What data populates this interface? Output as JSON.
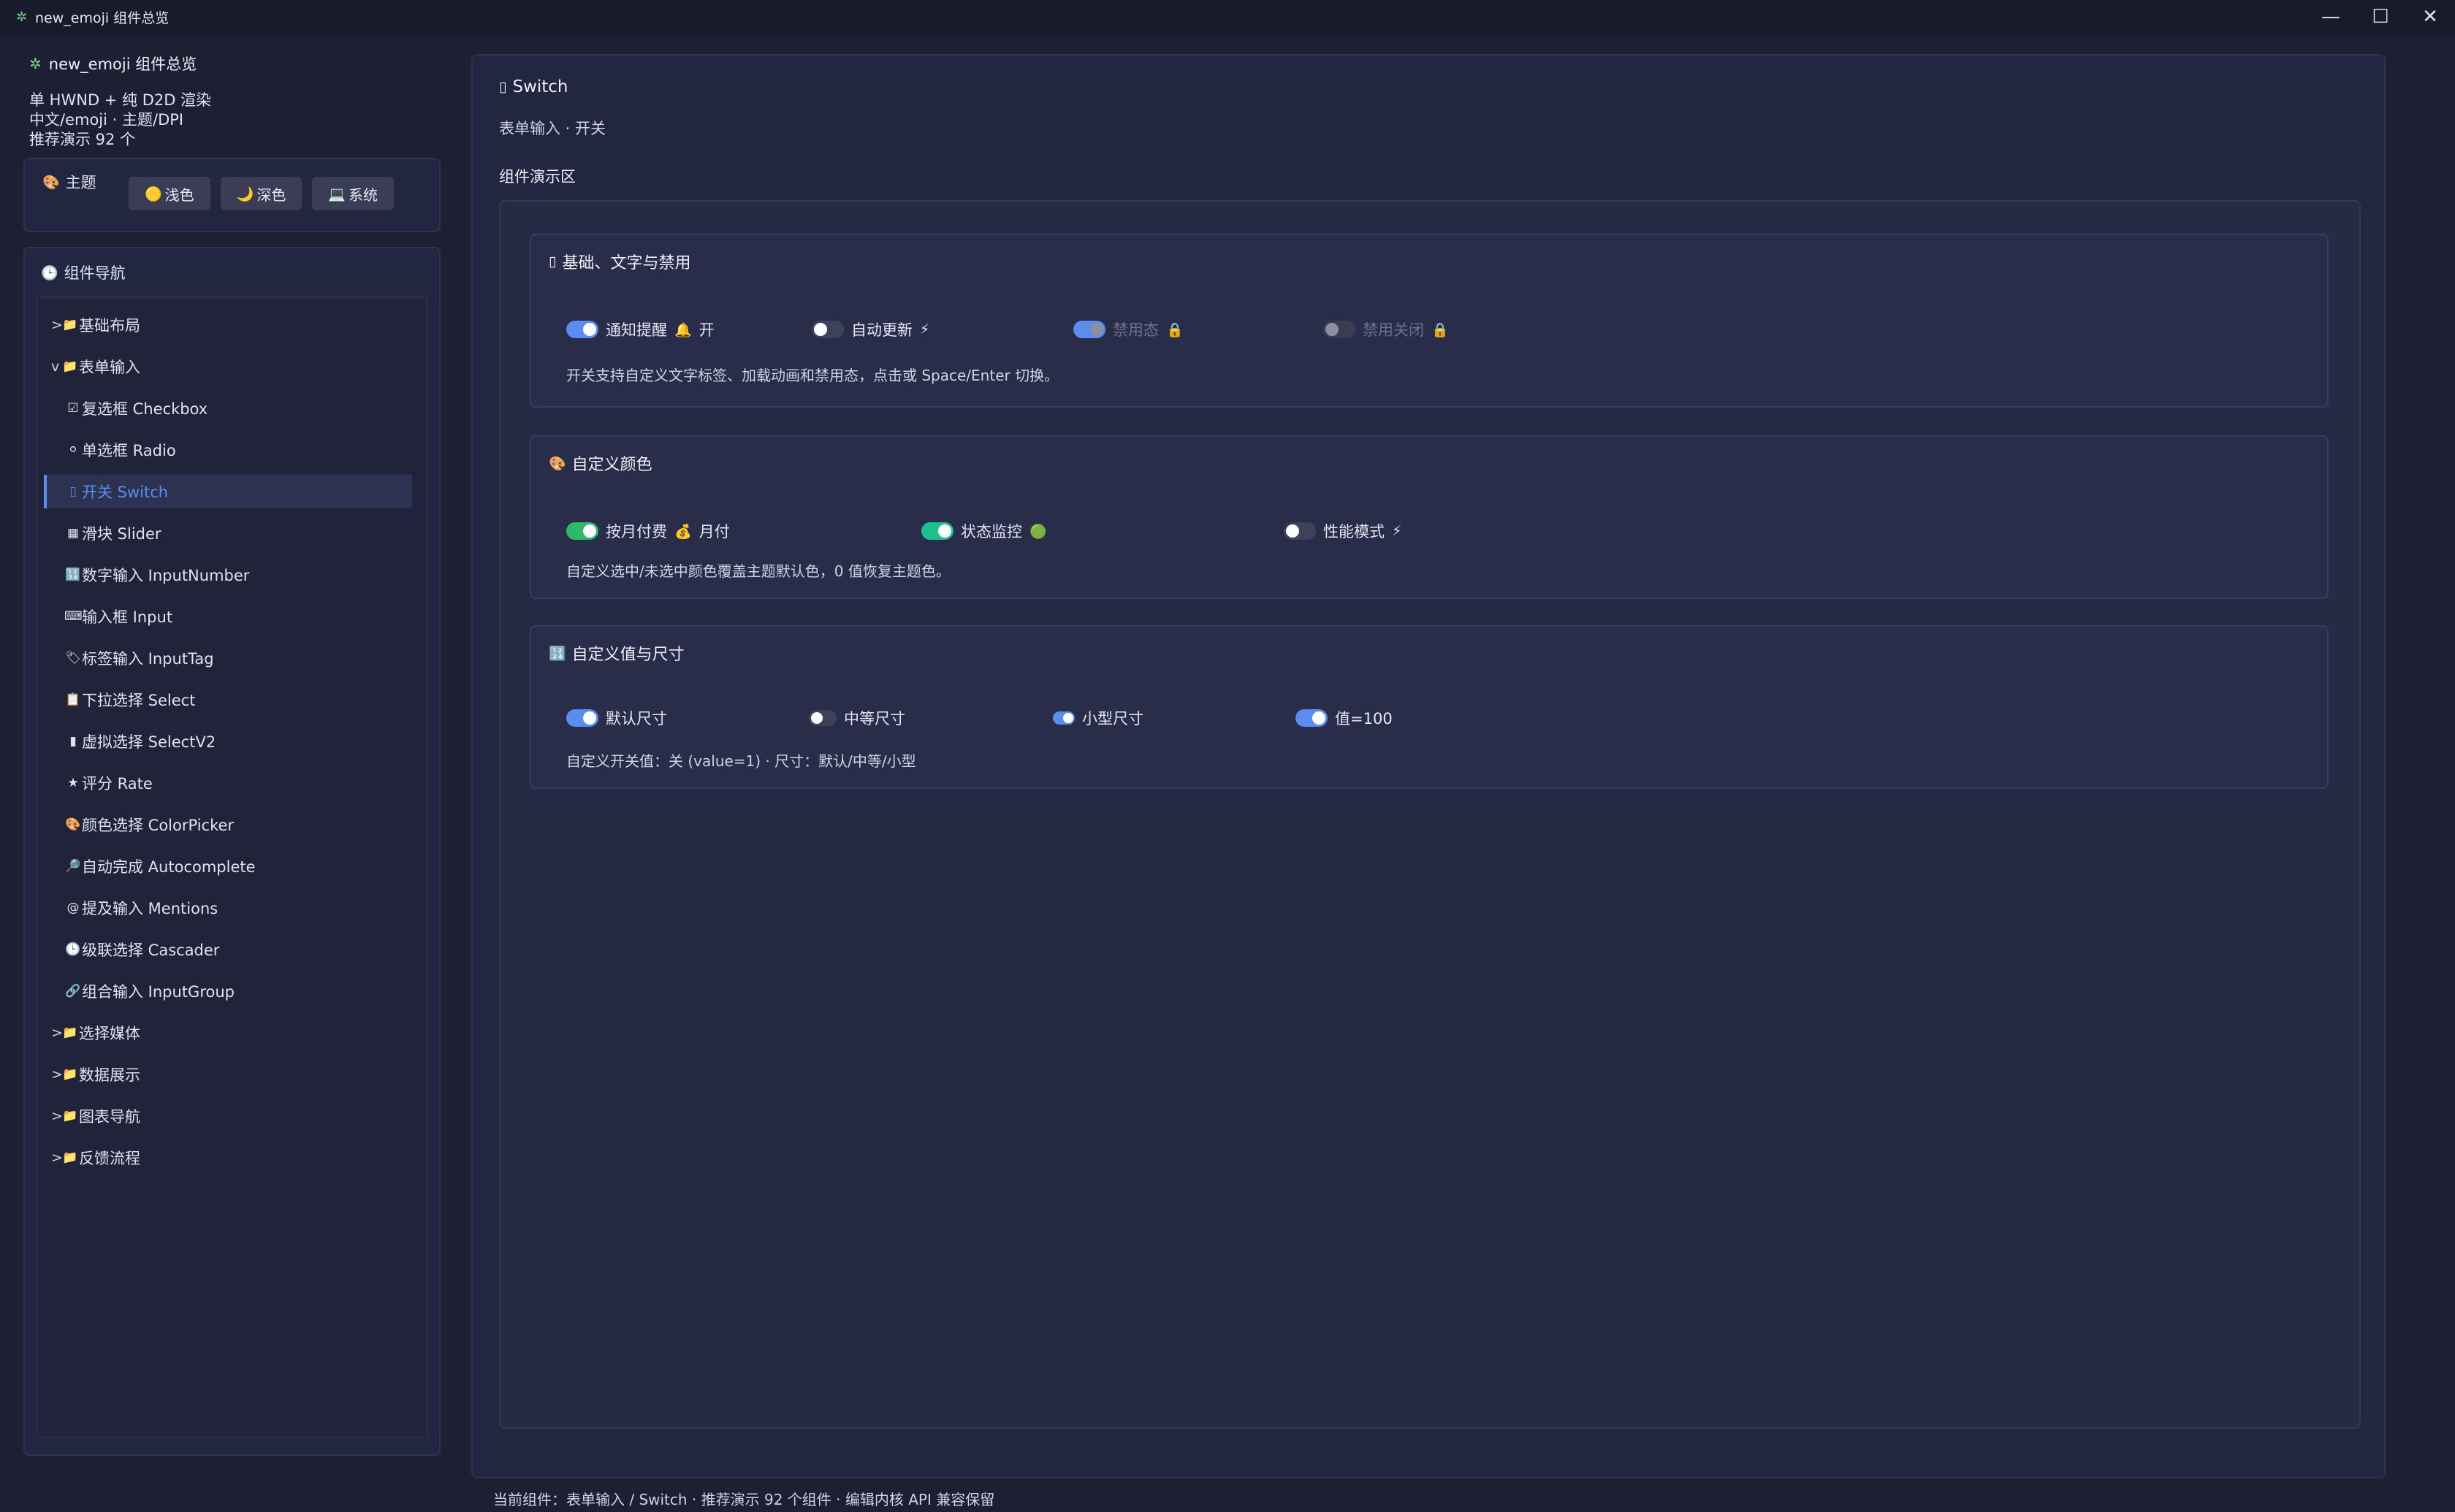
{
  "window": {
    "title": "new_emoji 组件总览",
    "controls": {
      "minimize": "—",
      "maximize": "☐",
      "close": "✕"
    }
  },
  "sidebar": {
    "app_name": "new_emoji 组件总览",
    "info_lines": [
      "单 HWND + 纯 D2D 渲染",
      "中文/emoji · 主题/DPI",
      "推荐演示 92 个"
    ],
    "theme": {
      "label": "主题",
      "buttons": [
        {
          "icon": "🟡",
          "label": "浅色"
        },
        {
          "icon": "🌙",
          "label": "深色"
        },
        {
          "icon": "💻",
          "label": "系统"
        }
      ]
    },
    "nav": {
      "title": "组件导航",
      "items": [
        {
          "arrow": ">",
          "icon": "📁",
          "label": "基础布局",
          "level": 0
        },
        {
          "arrow": "v",
          "icon": "📁",
          "label": "表单输入",
          "level": 0
        },
        {
          "icon": "☑",
          "label": "复选框 Checkbox",
          "level": 1
        },
        {
          "icon": "⚪",
          "label": "单选框 Radio",
          "level": 1
        },
        {
          "icon": "▯",
          "label": "开关 Switch",
          "level": 1,
          "active": true
        },
        {
          "icon": "▦",
          "label": "滑块 Slider",
          "level": 1
        },
        {
          "icon": "🔢",
          "label": "数字输入 InputNumber",
          "level": 1
        },
        {
          "icon": "⌨",
          "label": "输入框 Input",
          "level": 1
        },
        {
          "icon": "🏷",
          "label": "标签输入 InputTag",
          "level": 1
        },
        {
          "icon": "📋",
          "label": "下拉选择 Select",
          "level": 1
        },
        {
          "icon": "▮",
          "label": "虚拟选择 SelectV2",
          "level": 1
        },
        {
          "icon": "★",
          "label": "评分 Rate",
          "level": 1
        },
        {
          "icon": "🎨",
          "label": "颜色选择 ColorPicker",
          "level": 1
        },
        {
          "icon": "🔎",
          "label": "自动完成 Autocomplete",
          "level": 1
        },
        {
          "icon": "@",
          "label": "提及输入 Mentions",
          "level": 1
        },
        {
          "icon": "🕒",
          "label": "级联选择 Cascader",
          "level": 1
        },
        {
          "icon": "🔗",
          "label": "组合输入 InputGroup",
          "level": 1
        },
        {
          "arrow": ">",
          "icon": "📁",
          "label": "选择媒体",
          "level": 0
        },
        {
          "arrow": ">",
          "icon": "📁",
          "label": "数据展示",
          "level": 0
        },
        {
          "arrow": ">",
          "icon": "📁",
          "label": "图表导航",
          "level": 0
        },
        {
          "arrow": ">",
          "icon": "📁",
          "label": "反馈流程",
          "level": 0
        }
      ]
    }
  },
  "main": {
    "title": "Switch",
    "subtitle": "表单输入 · 开关",
    "demo_label": "组件演示区",
    "cards": [
      {
        "title": "基础、文字与禁用",
        "switches": [
          {
            "label": "通知提醒",
            "suffix_icon": "🔔",
            "suffix_text": "开",
            "on": true,
            "color": "blue",
            "disabled": false
          },
          {
            "label": "自动更新",
            "suffix_icon": "⚡",
            "suffix_text": "",
            "on": false,
            "color": "blue",
            "disabled": false
          },
          {
            "label": "禁用态",
            "suffix_icon": "🔒",
            "suffix_text": "",
            "on": true,
            "color": "blue",
            "disabled": true
          },
          {
            "label": "禁用关闭",
            "suffix_icon": "🔒",
            "suffix_text": "",
            "on": false,
            "color": "blue",
            "disabled": true
          }
        ],
        "description": "开关支持自定义文字标签、加载动画和禁用态，点击或 Space/Enter 切换。"
      },
      {
        "title": "自定义颜色",
        "switches": [
          {
            "label": "按月付费",
            "suffix_icon": "💰",
            "suffix_text": "月付",
            "on": true,
            "color": "green",
            "disabled": false
          },
          {
            "label": "状态监控",
            "suffix_icon": "🟢",
            "suffix_text": "",
            "on": true,
            "color": "teal",
            "disabled": false
          },
          {
            "label": "性能模式",
            "suffix_icon": "⚡",
            "suffix_text": "",
            "on": false,
            "color": "blue",
            "disabled": false
          }
        ],
        "description": "自定义选中/未选中颜色覆盖主题默认色，0 值恢复主题色。"
      },
      {
        "title": "自定义值与尺寸",
        "switches": [
          {
            "label": "默认尺寸",
            "on": true,
            "size": "default"
          },
          {
            "label": "中等尺寸",
            "on": false,
            "size": "medium"
          },
          {
            "label": "小型尺寸",
            "on": true,
            "size": "small"
          },
          {
            "label": "值=100",
            "on": true,
            "size": "default"
          }
        ],
        "description": "自定义开关值：关 (value=1) · 尺寸：默认/中等/小型"
      }
    ]
  },
  "status_bar": "当前组件：表单输入 / Switch · 推荐演示 92 个组件 · 编辑内核 API 兼容保留"
}
